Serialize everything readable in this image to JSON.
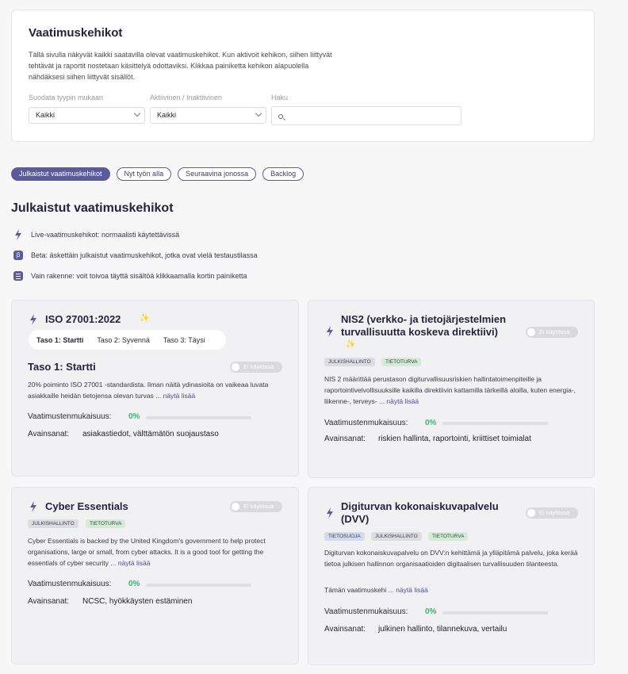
{
  "header": {
    "title": "Vaatimuskehikot",
    "intro": "Tällä sivulla näkyvät kaikki saatavilla olevat vaatimuskehikot. Kun aktivoit kehikon, siihen liittyvät tehtävät ja raportit nostetaan käsittelyä odottaviksi. Klikkaa painiketta kehikon alapuolella nähdäksesi siihen liittyvät sisällöt."
  },
  "filters": {
    "type_label": "Suodata tyypin mukaan",
    "type_value": "Kaikki",
    "active_label": "Aktiivinen / Inaktiivinen",
    "active_value": "Kaikki",
    "search_label": "Haku",
    "search_value": ""
  },
  "tabs": [
    "Julkaistut vaatimuskehikot",
    "Nyt työn alla",
    "Seuraavina jonossa",
    "Backlog"
  ],
  "section": {
    "title": "Julkaistut vaatimuskehikot",
    "legend": [
      {
        "icon": "bolt-icon",
        "text": "Live-vaatimuskehikot: normaalisti käytettävissä"
      },
      {
        "icon": "beta-icon",
        "text": "Beta: äskettäin julkaistut vaatimuskehikot, jotka ovat vielä testaustilassa"
      },
      {
        "icon": "structure-icon",
        "text": "Vain rakenne: voit toivoa täyttä sisältöä klikkaamalla kortin painiketta"
      }
    ]
  },
  "common": {
    "toggle_label": "Ei käytössä",
    "compliance_label": "Vaatimustenmukaisuus:",
    "keywords_label": "Avainsanat:",
    "more": "... näytä lisää"
  },
  "cards": {
    "iso": {
      "title": "ISO 27001:2022",
      "levels": [
        "Taso 1: Startti",
        "Taso 2: Syvennä",
        "Taso 3: Täysi"
      ],
      "level_title": "Taso 1: Startti",
      "desc": "20% poiminto ISO 27001 -standardista. Ilman näitä ydinasioita on vaikeaa luvata asiakkaille heidän tietojensa olevan turvas",
      "compliance": "0%",
      "keywords": "asiakastiedot, välttämätön suojaustaso"
    },
    "nis2": {
      "title": "NIS2 (verkko- ja tietojärjestelmien turvallisuutta koskeva direktiivi)",
      "tags": [
        "JULKISHALLINTO",
        "TIETOTURVA"
      ],
      "desc": "NIS 2 määrittää perustason digiturvallisuusriskien hallintatoimenpiteille ja raportointivelvollisuuksille kaikilla direktiivin kattamilla tärkeillä aloilla, kuten energia-, liikenne-, terveys-",
      "compliance": "0%",
      "keywords": "riskien hallinta, raportointi, kriittiset toimialat"
    },
    "cyber": {
      "title": "Cyber Essentials",
      "tags": [
        "JULKISHALLINTO",
        "TIETOTURVA"
      ],
      "desc": "Cyber Essentials is backed by the United Kingdom's government to help protect organisations, large or small, from cyber attacks. It is a good tool for getting the essentials of cyber security",
      "compliance": "0%",
      "keywords": "NCSC, hyökkäysten estäminen"
    },
    "dvv": {
      "title": "Digiturvan kokonaiskuvapalvelu (DVV)",
      "tags": [
        "TIETOSUOJA",
        "JULKISHALLINTO",
        "TIETOTURVA"
      ],
      "desc": "Digiturvan kokonaiskuvapalvelu on DVV:n kehittämä ja ylläpitämä palvelu, joka kerää tietoa julkisen hallinnon organisaatioiden digitaalisen turvallisuuden tilanteesta.",
      "desc2": "Tämän vaatimuskehi",
      "compliance": "0%",
      "keywords": "julkinen hallinto, tilannekuva, vertailu"
    }
  }
}
